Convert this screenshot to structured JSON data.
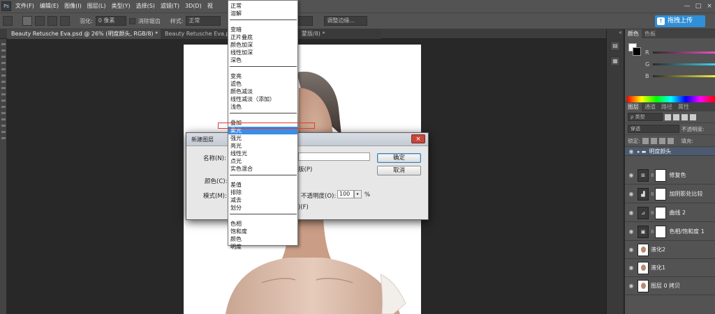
{
  "menubar": {
    "logo": "Ps",
    "items": [
      "文件(F)",
      "编辑(E)",
      "图像(I)",
      "图层(L)",
      "类型(Y)",
      "选择(S)",
      "滤镜(T)",
      "3D(D)",
      "视"
    ],
    "window_controls": [
      "—",
      "□",
      "×"
    ]
  },
  "options_bar": {
    "feather_label": "羽化:",
    "feather_value": "0 像素",
    "antialias_label": "消除锯齿",
    "style_label": "样式:",
    "style_value": "正常",
    "refine_edge": "调整边缘...",
    "upload_label": "拖拽上传"
  },
  "tabs": [
    {
      "label": "Beauty Retusche Eva.psd @ 26% (明度颜头, RGB/8) *",
      "close": "×"
    },
    {
      "label": "Beauty Retusche Eva.psd"
    },
    {
      "label": "蒙版/8) *"
    }
  ],
  "dock": {
    "collapse": "«"
  },
  "color_panel": {
    "tabs": [
      "颜色",
      "色板"
    ],
    "r_label": "R",
    "g_label": "G",
    "b_label": "B",
    "colors": {
      "r": "#f04fbd",
      "g": "#3fd3e6",
      "b": "#f1ef3a"
    }
  },
  "layers_panel": {
    "tabs": [
      "图层",
      "通道",
      "路径",
      "属性"
    ],
    "filter_label": "ρ 类型",
    "blend_mode": "穿透",
    "opacity_label": "不透明度:",
    "lock_label": "锁定:",
    "fill_label": "填充:",
    "layers": [
      {
        "name": "明度颜头",
        "kind": "group",
        "chain": "",
        "icon": "▸ ▬"
      },
      {
        "name": "修复色",
        "kind": "adjustment",
        "chain": "8",
        "icon": "⊠"
      },
      {
        "name": "加阴影处比较",
        "kind": "adjustment",
        "chain": "8",
        "icon": "▟"
      },
      {
        "name": "曲线 2",
        "kind": "adjustment",
        "chain": "8",
        "icon": "⊿"
      },
      {
        "name": "色相/饱和度 1",
        "kind": "adjustment",
        "chain": "8",
        "icon": "▣"
      },
      {
        "name": "液化2",
        "kind": "pixel",
        "chain": ""
      },
      {
        "name": "液化1",
        "kind": "pixel",
        "chain": ""
      },
      {
        "name": "图层 0 拷贝",
        "kind": "pixel",
        "chain": ""
      }
    ]
  },
  "dialog": {
    "title": "新建图层",
    "close": "×",
    "name_label": "名称(N):",
    "name_value": "",
    "clip_label": "版(P)",
    "color_label": "颜色(C):",
    "mode_label": "模式(M):",
    "opacity_label": "不透明度(O):",
    "opacity_value": "100",
    "opacity_arrow": "▸",
    "percent": "%",
    "fill_label": ")(F)",
    "ok": "确定",
    "cancel": "取消"
  },
  "blend_menu": {
    "groups": [
      [
        "正常",
        "溶解"
      ],
      [
        "变暗",
        "正片叠底",
        "颜色加深",
        "线性加深",
        "深色"
      ],
      [
        "变亮",
        "滤色",
        "颜色减淡",
        "线性减淡（添加）",
        "浅色"
      ],
      [
        "叠加",
        "柔光",
        "强光",
        "亮光",
        "线性光",
        "点光",
        "实色混合"
      ],
      [
        "差值",
        "排除",
        "减去",
        "划分"
      ],
      [
        "色相",
        "饱和度",
        "颜色",
        "明度"
      ]
    ],
    "highlighted": "柔光"
  }
}
